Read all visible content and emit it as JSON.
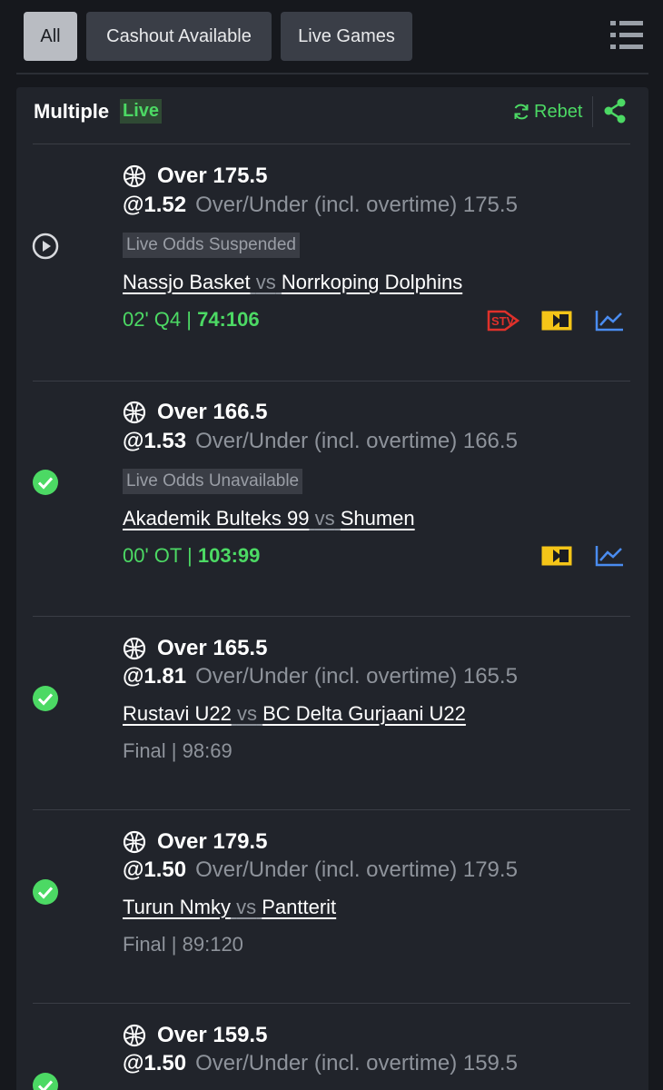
{
  "filters": {
    "all": "All",
    "cashout": "Cashout Available",
    "live": "Live Games",
    "active": "All"
  },
  "header": {
    "title": "Multiple",
    "live_badge": "Live",
    "rebet": "Rebet"
  },
  "colors": {
    "green": "#4cd964",
    "yellow": "#f5c518",
    "blue": "#4a8cf0",
    "red": "#e0312b"
  },
  "bets": [
    {
      "status": "live-play-icon",
      "title": "Over 175.5",
      "odds": "@1.52",
      "market": "Over/Under (incl. overtime) 175.5",
      "badge": "Live Odds Suspended",
      "home": "Nassjo Basket",
      "vs": "vs",
      "away": "Norrkoping Dolphins",
      "time": "02' Q4 | ",
      "score": "74:106",
      "icons": [
        "stv-icon",
        "live-tracker-icon",
        "statistics-icon"
      ]
    },
    {
      "status": "won-check-icon",
      "title": "Over 166.5",
      "odds": "@1.53",
      "market": "Over/Under (incl. overtime) 166.5",
      "badge": "Live Odds Unavailable",
      "home": "Akademik Bulteks 99",
      "vs": "vs",
      "away": "Shumen",
      "time": "00' OT | ",
      "score": "103:99",
      "icons": [
        "live-tracker-icon",
        "statistics-icon"
      ]
    },
    {
      "status": "won-check-icon",
      "title": "Over 165.5",
      "odds": "@1.81",
      "market": "Over/Under (incl. overtime)  165.5",
      "home": "Rustavi U22",
      "vs": "vs",
      "away": "BC Delta Gurjaani U22",
      "final": "Final | 98:69"
    },
    {
      "status": "won-check-icon",
      "title": "Over 179.5",
      "odds": "@1.50",
      "market": "Over/Under (incl. overtime) 179.5",
      "home": "Turun Nmky",
      "vs": "vs",
      "away": "Pantterit",
      "final": "Final | 89:120"
    },
    {
      "status": "won-check-icon",
      "title": "Over 159.5",
      "odds": "@1.50",
      "market": "Over/Under (incl. overtime) 159.5"
    }
  ]
}
